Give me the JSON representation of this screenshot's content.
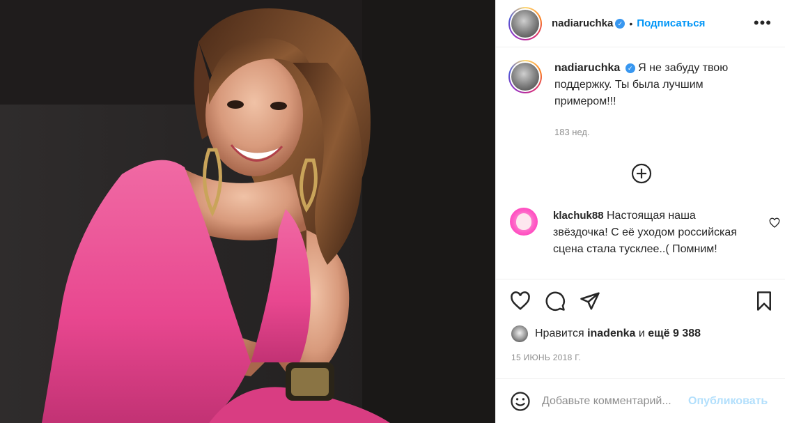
{
  "post": {
    "author": "nadiaruchka",
    "follow_label": "Подписаться",
    "more_label": "•••",
    "dot": "•",
    "verified_mark": "✓"
  },
  "caption": {
    "author": "nadiaruchka",
    "text": "Я не забуду твою поддержку. Ты была лучшим примером!!!",
    "time_ago": "183 нед."
  },
  "comments": [
    {
      "author": "klachuk88",
      "text": "Настоящая наша звёздочка! С её уходом российская сцена стала тусклее..( Помним!"
    }
  ],
  "likes": {
    "prefix": "Нравится",
    "user": "inadenka",
    "connector": "и",
    "count_text": "ещё 9 388"
  },
  "date": "15 ИЮНЬ 2018 Г.",
  "add_comment": {
    "placeholder": "Добавьте комментарий...",
    "publish_label": "Опубликовать"
  },
  "icons": {
    "like": "heart-icon",
    "comment": "comment-icon",
    "share": "paper-plane-icon",
    "save": "bookmark-icon",
    "load_more": "plus-circle-icon",
    "emoji": "smiley-icon",
    "comment_like": "heart-icon"
  },
  "colors": {
    "follow": "#0095f6",
    "publish_disabled": "#b2dffc",
    "dress": "#e8478f"
  }
}
